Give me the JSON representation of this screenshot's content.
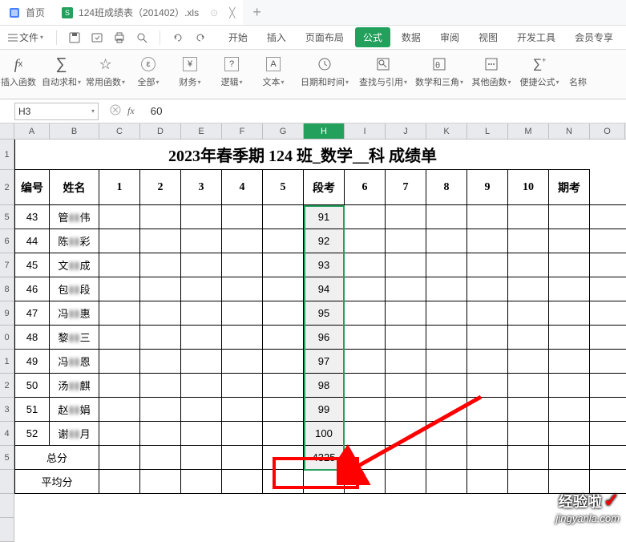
{
  "tabs": {
    "home": "首页",
    "file": "124班成绩表（201402）.xls"
  },
  "menu": {
    "file_label": "文件",
    "tabs": [
      "开始",
      "插入",
      "页面布局",
      "公式",
      "数据",
      "审阅",
      "视图",
      "开发工具",
      "会员专享"
    ]
  },
  "ribbon": {
    "insert_fn": "插入函数",
    "autosum": "自动求和",
    "common": "常用函数",
    "all": "全部",
    "financial": "财务",
    "logical": "逻辑",
    "text": "文本",
    "datetime": "日期和时间",
    "lookup": "查找与引用",
    "math": "数学和三角",
    "other": "其他函数",
    "convenient": "便捷公式",
    "name": "名称"
  },
  "namebox": "H3",
  "formula": "60",
  "cols": [
    "A",
    "B",
    "C",
    "D",
    "E",
    "F",
    "G",
    "H",
    "I",
    "J",
    "K",
    "L",
    "M",
    "N",
    "O"
  ],
  "row_nums": [
    "1",
    "2",
    "5",
    "6",
    "7",
    "8",
    "9",
    "0",
    "1",
    "2",
    "3",
    "4",
    "5",
    "",
    "",
    ""
  ],
  "title": "2023年春季期 124 班_数学__科 成绩单",
  "headers": [
    "编号",
    "姓名",
    "1",
    "2",
    "3",
    "4",
    "5",
    "段考",
    "6",
    "7",
    "8",
    "9",
    "10",
    "期考"
  ],
  "rows": [
    {
      "id": "43",
      "name": "管▮▮伟",
      "h": "91"
    },
    {
      "id": "44",
      "name": "陈▮▮彩",
      "h": "92"
    },
    {
      "id": "45",
      "name": "文▮▮成",
      "h": "93"
    },
    {
      "id": "46",
      "name": "包▮▮段",
      "h": "94"
    },
    {
      "id": "47",
      "name": "冯▮▮惠",
      "h": "95"
    },
    {
      "id": "48",
      "name": "黎▮▮三",
      "h": "96"
    },
    {
      "id": "49",
      "name": "冯▮▮恩",
      "h": "97"
    },
    {
      "id": "50",
      "name": "汤▮▮麒",
      "h": "98"
    },
    {
      "id": "51",
      "name": "赵▮▮娟",
      "h": "99"
    },
    {
      "id": "52",
      "name": "谢▮▮月",
      "h": "100"
    }
  ],
  "total_label": "总分",
  "total_value": "4325",
  "avg_label": "平均分",
  "watermark": {
    "text": "经验啦",
    "url": "jingyanla.com"
  }
}
